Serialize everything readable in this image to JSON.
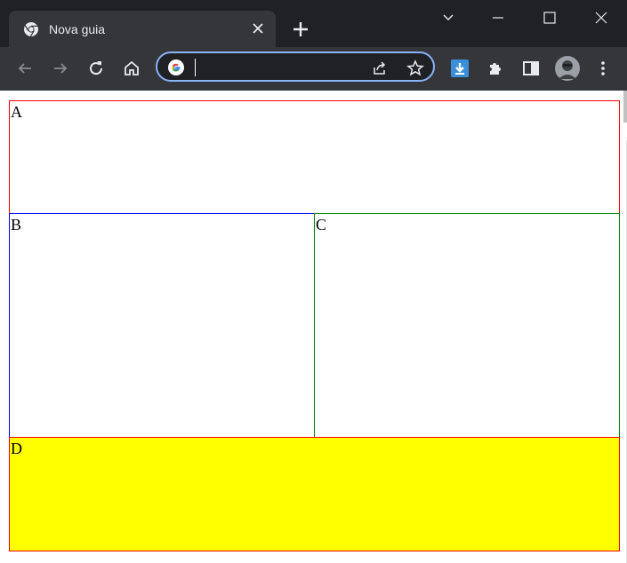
{
  "browser": {
    "tab_title": "Nova guia",
    "address_value": "",
    "icons": {
      "tab_favicon": "chrome-icon",
      "tab_close": "close-icon",
      "new_tab": "plus-icon",
      "tab_search": "chevron-down-icon",
      "minimize": "minimize-icon",
      "maximize": "maximize-icon",
      "close_window": "close-icon",
      "back": "back-arrow-icon",
      "forward": "forward-arrow-icon",
      "reload": "reload-icon",
      "home": "home-icon",
      "search_engine": "google-icon",
      "share": "share-icon",
      "bookmark": "star-icon",
      "download": "download-icon",
      "extensions": "puzzle-icon",
      "side_panel": "side-panel-icon",
      "profile": "avatar",
      "menu": "kebab-menu-icon"
    },
    "colors": {
      "titlebar": "#202124",
      "toolbar": "#35363a",
      "omnibox_border": "#8ab4f8"
    }
  },
  "page": {
    "regions": [
      {
        "label": "A",
        "background": "#ffffff",
        "border": "#ff0000"
      },
      {
        "label": "B",
        "background": "#ffffff",
        "border": "#0000ff"
      },
      {
        "label": "C",
        "background": "#ffffff",
        "border": "#008000"
      },
      {
        "label": "D",
        "background": "#ffff00",
        "border": "#ff0000"
      }
    ]
  }
}
